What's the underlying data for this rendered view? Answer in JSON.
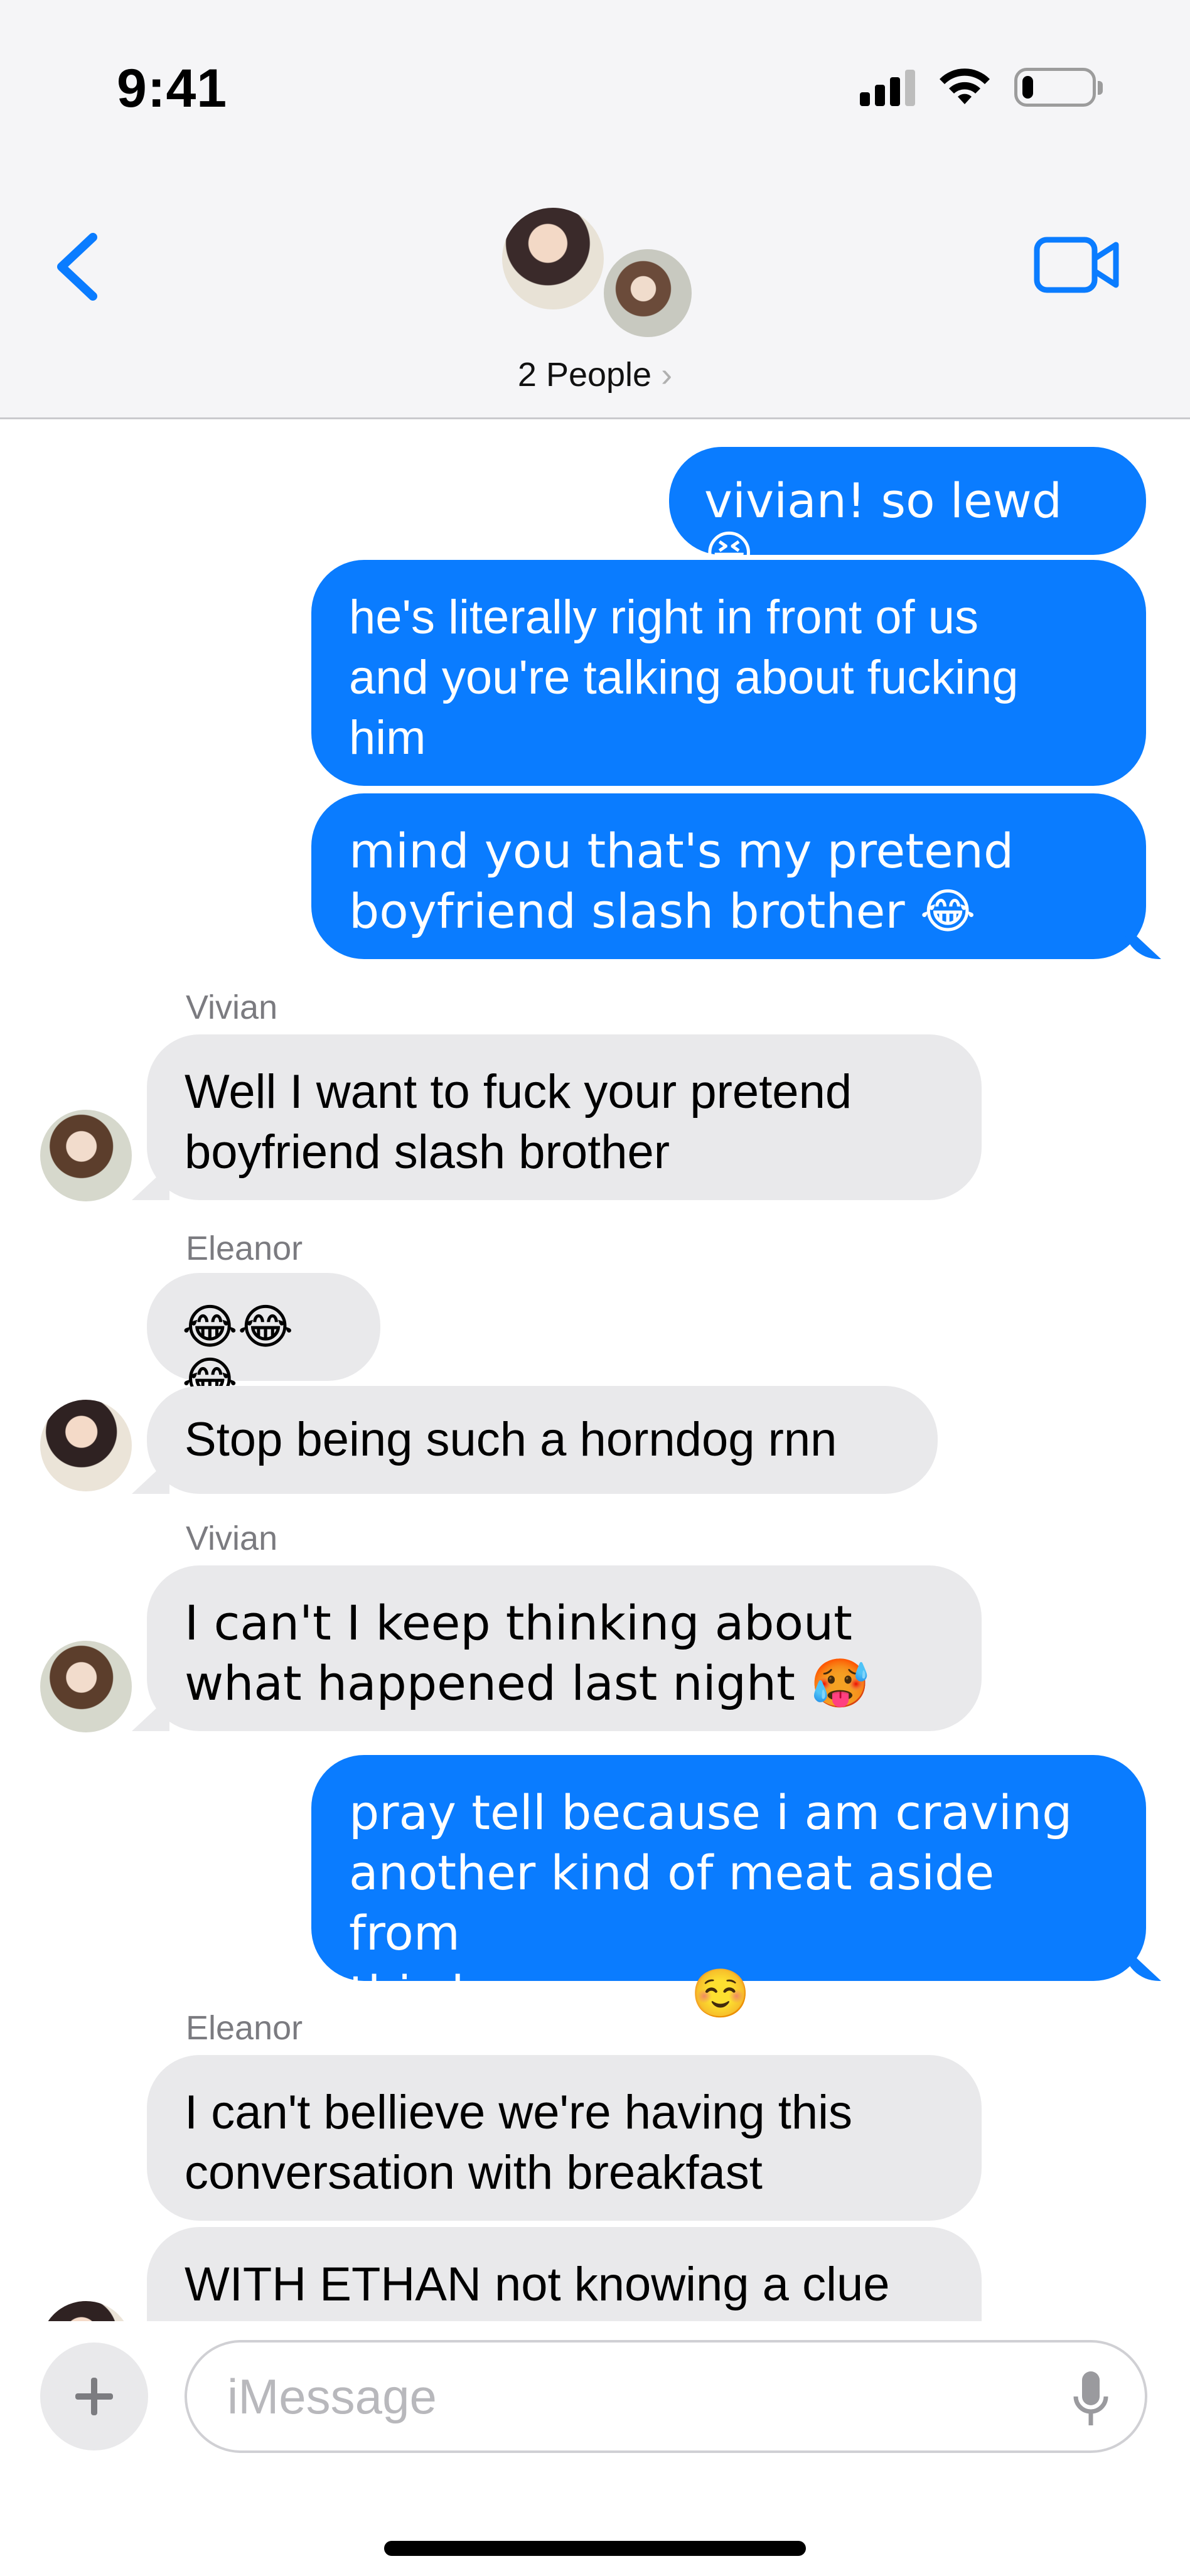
{
  "status_bar": {
    "time": "9:41",
    "signal_bars": 4,
    "battery_level": 0.15
  },
  "header": {
    "title": "2 People",
    "chevron": "›"
  },
  "colors": {
    "sent_bubble": "#0a7cff",
    "received_bubble": "#e9e9eb",
    "accent": "#0a7cff"
  },
  "messages": [
    {
      "from": "me",
      "text": "vivian! so lewd 😆"
    },
    {
      "from": "me",
      "text": "he's literally right in front of us\nand you're talking about fucking\nhim"
    },
    {
      "from": "me",
      "text": "mind you that's my pretend\nboyfriend slash brother 😂"
    },
    {
      "from": "Vivian",
      "sender_label": "Vivian",
      "text": "Well I want to fuck your pretend\nboyfriend slash brother"
    },
    {
      "from": "Eleanor",
      "sender_label": "Eleanor",
      "text": "😂😂😂"
    },
    {
      "from": "Eleanor",
      "text": "Stop being such a horndog rnn"
    },
    {
      "from": "Vivian",
      "sender_label": "Vivian",
      "text": "I can't I keep thinking about\nwhat happened last night 🥵"
    },
    {
      "from": "me",
      "text": "pray tell because i am craving\nanother kind of meat aside from\nthis bacon rn..☺️"
    },
    {
      "from": "Eleanor",
      "sender_label": "Eleanor",
      "text": "I can't bellieve we're having this\nconversation with breakfast"
    },
    {
      "from": "Eleanor",
      "text": "WITH ETHAN not knowing a clue\nabout what we're talking about"
    }
  ],
  "composer": {
    "placeholder": "iMessage"
  }
}
